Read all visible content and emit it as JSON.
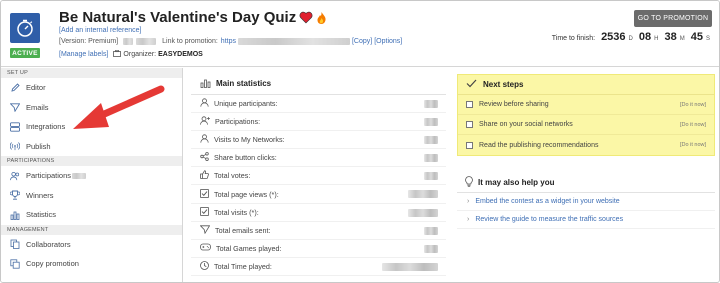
{
  "header": {
    "title": "Be Natural's Valentine's Day Quiz",
    "status_badge": "ACTIVE",
    "add_reference": "[Add an internal reference]",
    "version_label": "[Version: Premium]",
    "link_label": "Link to promotion:",
    "link_prefix": "https",
    "copy_label": "[Copy]",
    "options_label": "[Options]",
    "manage_labels": "[Manage labels]",
    "organizer_label": "Organizer:",
    "organizer_name": "EASYDEMOS",
    "promo_button": "GO TO PROMOTION",
    "finish_label": "Time to finish:",
    "finish": [
      {
        "num": "2536",
        "unit": "D"
      },
      {
        "num": "08",
        "unit": "H"
      },
      {
        "num": "38",
        "unit": "M"
      },
      {
        "num": "45",
        "unit": "S"
      }
    ]
  },
  "sidebar": {
    "sections": [
      {
        "heading": "SET UP",
        "items": [
          "Editor",
          "Emails",
          "Integrations",
          "Publish"
        ]
      },
      {
        "heading": "PARTICIPATIONS",
        "items": [
          "Participations",
          "Winners",
          "Statistics"
        ]
      },
      {
        "heading": "MANAGEMENT",
        "items": [
          "Collaborators",
          "Copy promotion"
        ]
      }
    ]
  },
  "stats": {
    "title": "Main statistics",
    "rows": [
      {
        "label": "Unique participants:",
        "icon": "user-icon"
      },
      {
        "label": "Participations:",
        "icon": "user-plus-icon"
      },
      {
        "label": "Visits to My Networks:",
        "icon": "user-icon"
      },
      {
        "label": "Share button clicks:",
        "icon": "share-icon"
      },
      {
        "label": "Total votes:",
        "icon": "thumbs-up-icon"
      },
      {
        "label": "Total page views (*):",
        "icon": "checkbox-icon"
      },
      {
        "label": "Total visits (*):",
        "icon": "checkbox-icon"
      },
      {
        "label": "Total emails sent:",
        "icon": "send-icon"
      },
      {
        "label": "Total Games played:",
        "icon": "gamepad-icon"
      },
      {
        "label": "Total Time played:",
        "icon": "clock-icon"
      }
    ]
  },
  "next_steps": {
    "title": "Next steps",
    "do_now": "[Do it now]",
    "rows": [
      "Review before sharing",
      "Share on your social networks",
      "Read the publishing recommendations"
    ]
  },
  "help": {
    "title": "It may also help you",
    "rows": [
      "Embed the contest as a widget in your website",
      "Review the guide to measure the traffic sources"
    ]
  },
  "colors": {
    "accent_blue": "#2f5ea8",
    "active_green": "#4caf50",
    "arrow_red": "#e53935",
    "next_steps_bg": "#fbf7a6"
  }
}
